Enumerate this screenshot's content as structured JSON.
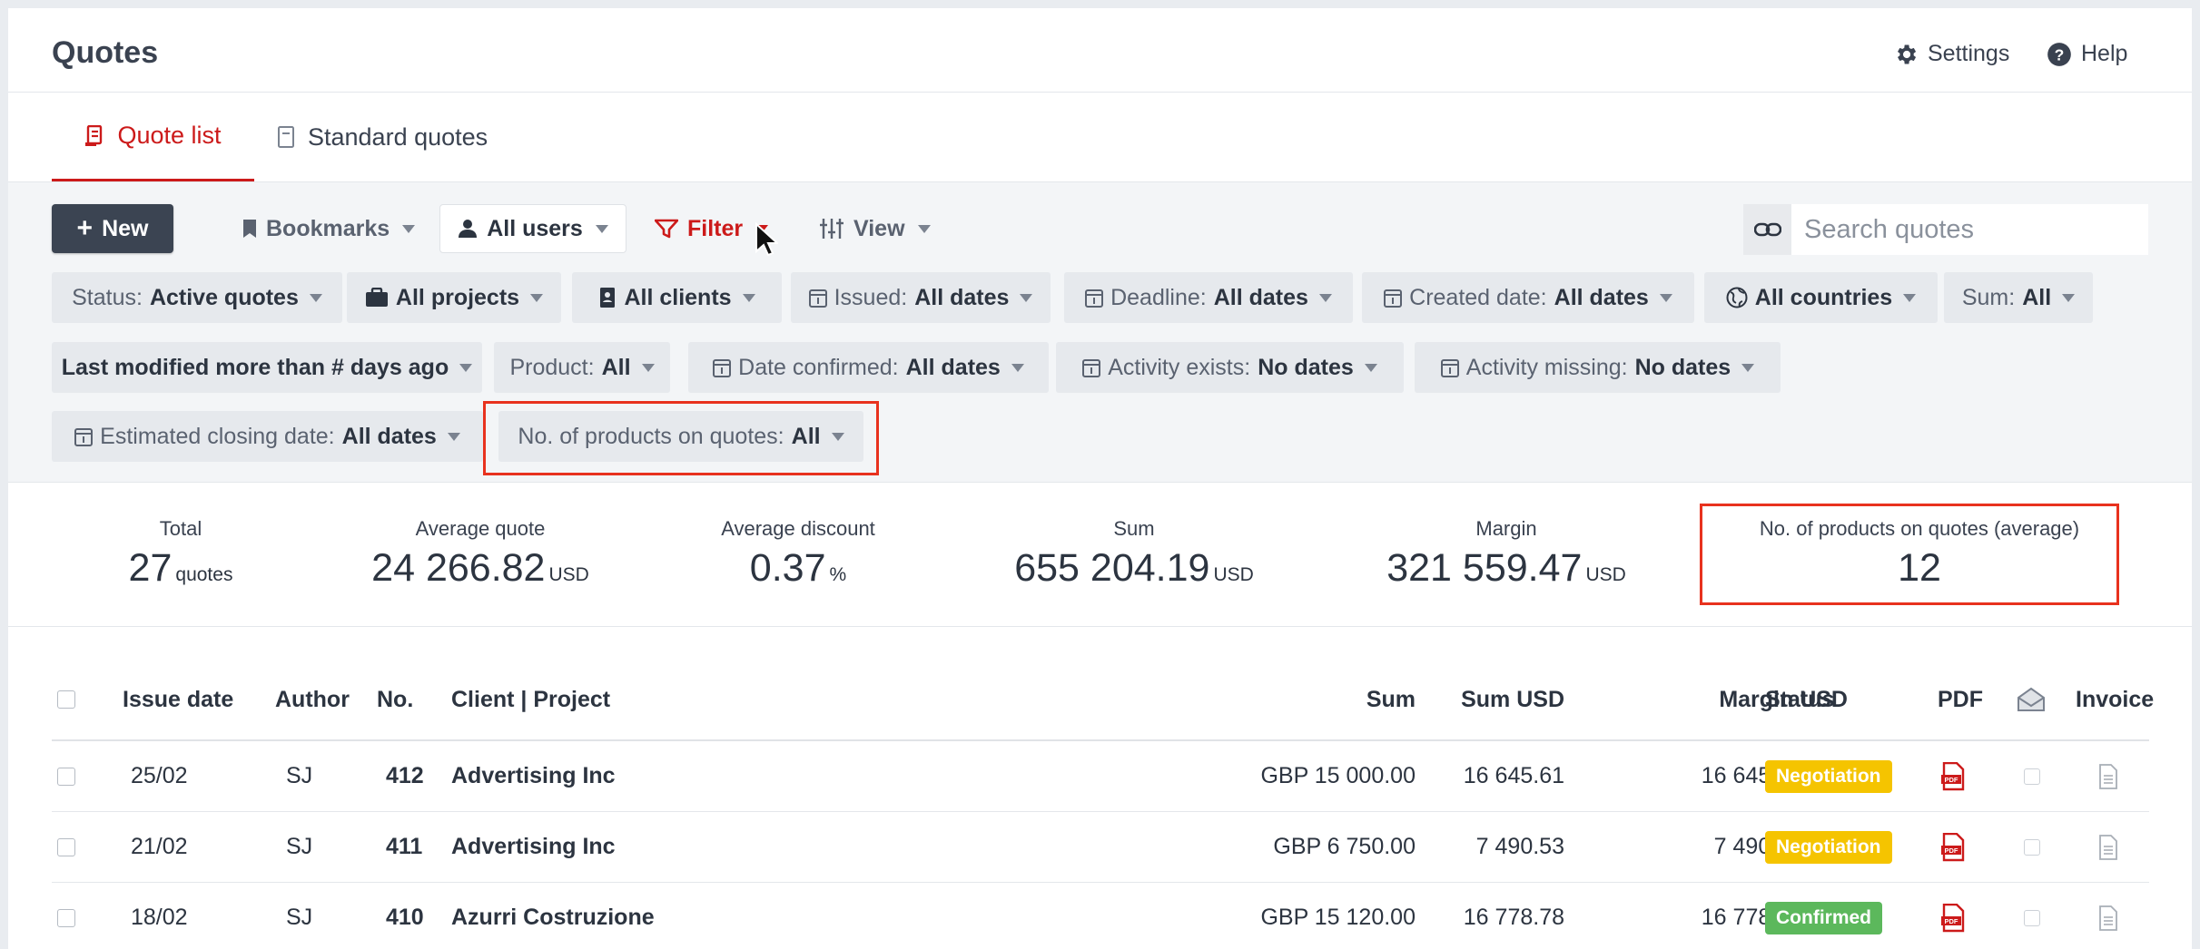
{
  "header": {
    "title": "Quotes",
    "settings_label": "Settings",
    "help_label": "Help"
  },
  "tabs": [
    {
      "label": "Quote list",
      "active": true
    },
    {
      "label": "Standard quotes",
      "active": false
    }
  ],
  "toolbar": {
    "new_label": "New",
    "bookmarks_label": "Bookmarks",
    "users_label": "All users",
    "filter_label": "Filter",
    "view_label": "View",
    "search_placeholder": "Search quotes"
  },
  "filters": {
    "status": {
      "label": "Status:",
      "value": "Active quotes"
    },
    "projects": {
      "value": "All projects"
    },
    "clients": {
      "value": "All clients"
    },
    "issued": {
      "label": "Issued:",
      "value": "All dates"
    },
    "deadline": {
      "label": "Deadline:",
      "value": "All dates"
    },
    "created": {
      "label": "Created date:",
      "value": "All dates"
    },
    "countries": {
      "value": "All countries"
    },
    "sum": {
      "label": "Sum:",
      "value": "All"
    },
    "last_modified": {
      "value": "Last modified more than # days ago"
    },
    "product": {
      "label": "Product:",
      "value": "All"
    },
    "date_confirmed": {
      "label": "Date confirmed:",
      "value": "All dates"
    },
    "activity_exists": {
      "label": "Activity exists:",
      "value": "No dates"
    },
    "activity_missing": {
      "label": "Activity missing:",
      "value": "No dates"
    },
    "est_closing": {
      "label": "Estimated closing date:",
      "value": "All dates"
    },
    "num_products": {
      "label": "No. of products on quotes:",
      "value": "All"
    }
  },
  "stats": {
    "total": {
      "label": "Total",
      "value": "27",
      "unit": "quotes"
    },
    "avg_quote": {
      "label": "Average quote",
      "value": "24 266.82",
      "unit": "USD"
    },
    "avg_discount": {
      "label": "Average discount",
      "value": "0.37",
      "unit": "%"
    },
    "sum": {
      "label": "Sum",
      "value": "655 204.19",
      "unit": "USD"
    },
    "margin": {
      "label": "Margin",
      "value": "321 559.47",
      "unit": "USD"
    },
    "avg_products": {
      "label": "No. of products on quotes (average)",
      "value": "12"
    }
  },
  "table": {
    "headers": {
      "issue_date": "Issue date",
      "author": "Author",
      "no": "No.",
      "client_project": "Client | Project",
      "sum": "Sum",
      "sum_usd": "Sum USD",
      "margin_usd": "Margin USD",
      "status": "Status",
      "pdf": "PDF",
      "invoice": "Invoice"
    },
    "rows": [
      {
        "issue_date": "25/02",
        "author": "SJ",
        "no": "412",
        "client": "Advertising Inc",
        "sum": "GBP 15 000.00",
        "sum_usd": "16 645.61",
        "margin_usd": "16 645.61",
        "status": "Negotiation"
      },
      {
        "issue_date": "21/02",
        "author": "SJ",
        "no": "411",
        "client": "Advertising Inc",
        "sum": "GBP 6 750.00",
        "sum_usd": "7 490.53",
        "margin_usd": "7 490.53",
        "status": "Negotiation"
      },
      {
        "issue_date": "18/02",
        "author": "SJ",
        "no": "410",
        "client": "Azurri Costruzione",
        "sum": "GBP 15 120.00",
        "sum_usd": "16 778.78",
        "margin_usd": "16 778.78",
        "status": "Confirmed"
      }
    ]
  },
  "colors": {
    "accent": "#cc1a1a",
    "negotiation": "#f5c400",
    "confirmed": "#5cb85c",
    "highlight": "#e8321e",
    "dark_button": "#3b4452"
  },
  "icons": [
    "gear-icon",
    "help-icon",
    "quote-list-icon",
    "document-icon",
    "plus-icon",
    "bookmark-icon",
    "user-icon",
    "filter-icon",
    "sliders-icon",
    "link-icon",
    "briefcase-icon",
    "client-icon",
    "calendar-icon",
    "globe-icon",
    "pdf-icon",
    "envelope-icon",
    "invoice-icon",
    "cursor-icon"
  ]
}
